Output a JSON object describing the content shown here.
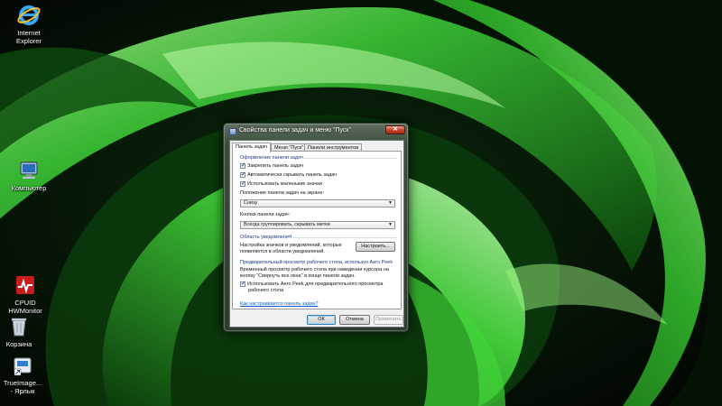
{
  "desktop": {
    "icons": [
      {
        "label_lines": [
          "Internet",
          "Explorer"
        ],
        "icon": "internet-explorer-icon"
      },
      {
        "label_lines": [
          "Компьютер"
        ],
        "icon": "computer-icon"
      },
      {
        "label_lines": [
          "CPUID",
          "HWMonitor"
        ],
        "icon": "hwmonitor-icon"
      },
      {
        "label_lines": [
          "Корзина"
        ],
        "icon": "recycle-bin-icon"
      },
      {
        "label_lines": [
          "TrueImage...",
          "- Ярлык"
        ],
        "icon": "trueimage-shortcut-icon"
      }
    ]
  },
  "dialog": {
    "title": "Свойства панели задач и меню \"Пуск\"",
    "close_label": "✕",
    "tabs": [
      {
        "label": "Панель задач",
        "active": true
      },
      {
        "label": "Меню \"Пуск\"",
        "active": false
      },
      {
        "label": "Панели инструментов",
        "active": false
      }
    ],
    "appearance": {
      "heading": "Оформление панели задач",
      "checkboxes": [
        {
          "label": "Закрепить панель задач",
          "checked": true
        },
        {
          "label": "Автоматически скрывать панель задач",
          "checked": true
        },
        {
          "label": "Использовать маленькие значки",
          "checked": true
        }
      ],
      "position_label": "Положение панели задач на экране:",
      "position_value": "Снизу",
      "buttons_label": "Кнопки панели задач:",
      "buttons_value": "Всегда группировать, скрывать метки"
    },
    "notification": {
      "heading": "Область уведомлений",
      "text_lines": [
        "Настройка значков и уведомлений, которые",
        "появляются в области уведомлений."
      ],
      "configure_button": "Настроить..."
    },
    "aero_peek": {
      "heading": "Предварительный просмотр рабочего стола, используя Aero Peek",
      "text_lines": [
        "Временный просмотр рабочего стола при наведении курсора на",
        "кнопку \"Свернуть все окна\" в конце панели задач."
      ],
      "checkbox_lines": [
        "Использовать Aero Peek для предварительного просмотра",
        "рабочего стола"
      ],
      "checked": true
    },
    "help_link": "Как настраивается панель задач?",
    "buttons": {
      "ok": "ОК",
      "cancel": "Отмена",
      "apply": "Применить"
    }
  },
  "colors": {
    "wallpaper_green": "#3fd13a",
    "wallpaper_dark": "#030803",
    "link_blue": "#0b5fc4",
    "heading_blue": "#1c3a78"
  }
}
